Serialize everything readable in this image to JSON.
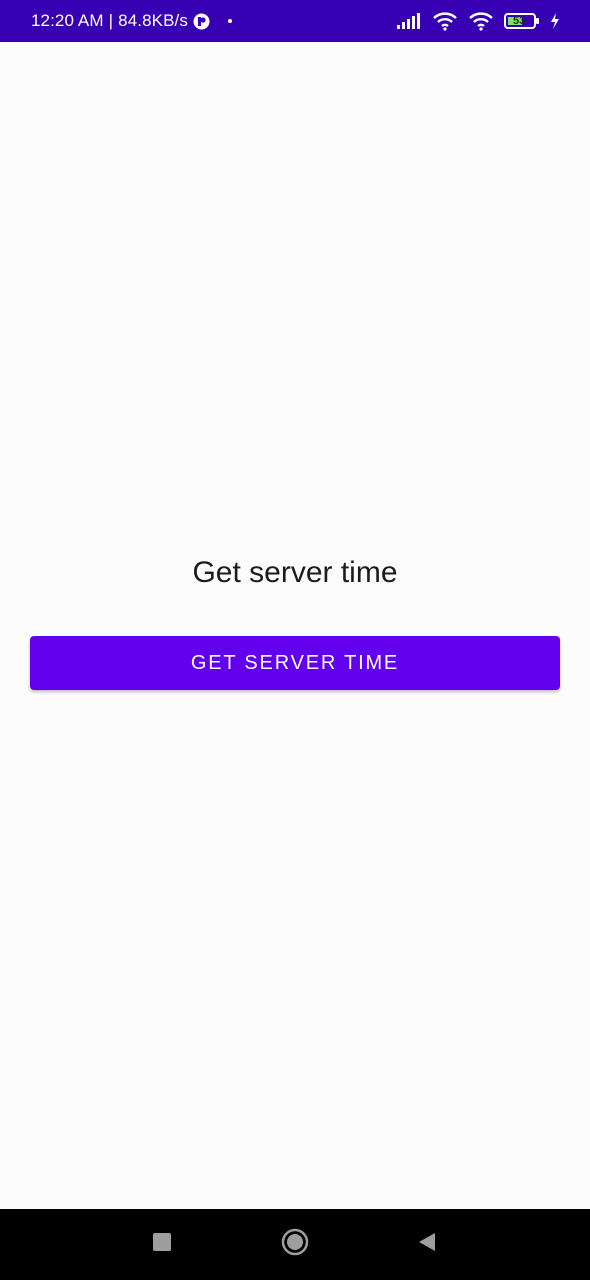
{
  "status_bar": {
    "time": "12:20 AM",
    "separator": "|",
    "network_speed": "84.8KB/s",
    "battery_level": "53",
    "background_color": "#3700b3",
    "icons": [
      "app-notification-icon",
      "dot-icon",
      "signal-icon",
      "wifi-icon",
      "hotspot-icon",
      "battery-icon",
      "charging-icon"
    ]
  },
  "main": {
    "label": "Get server time",
    "button_label": "GET SERVER TIME",
    "button_color": "#6200ee"
  },
  "nav_bar": {
    "icons": [
      "recents-icon",
      "home-icon",
      "back-icon"
    ]
  }
}
